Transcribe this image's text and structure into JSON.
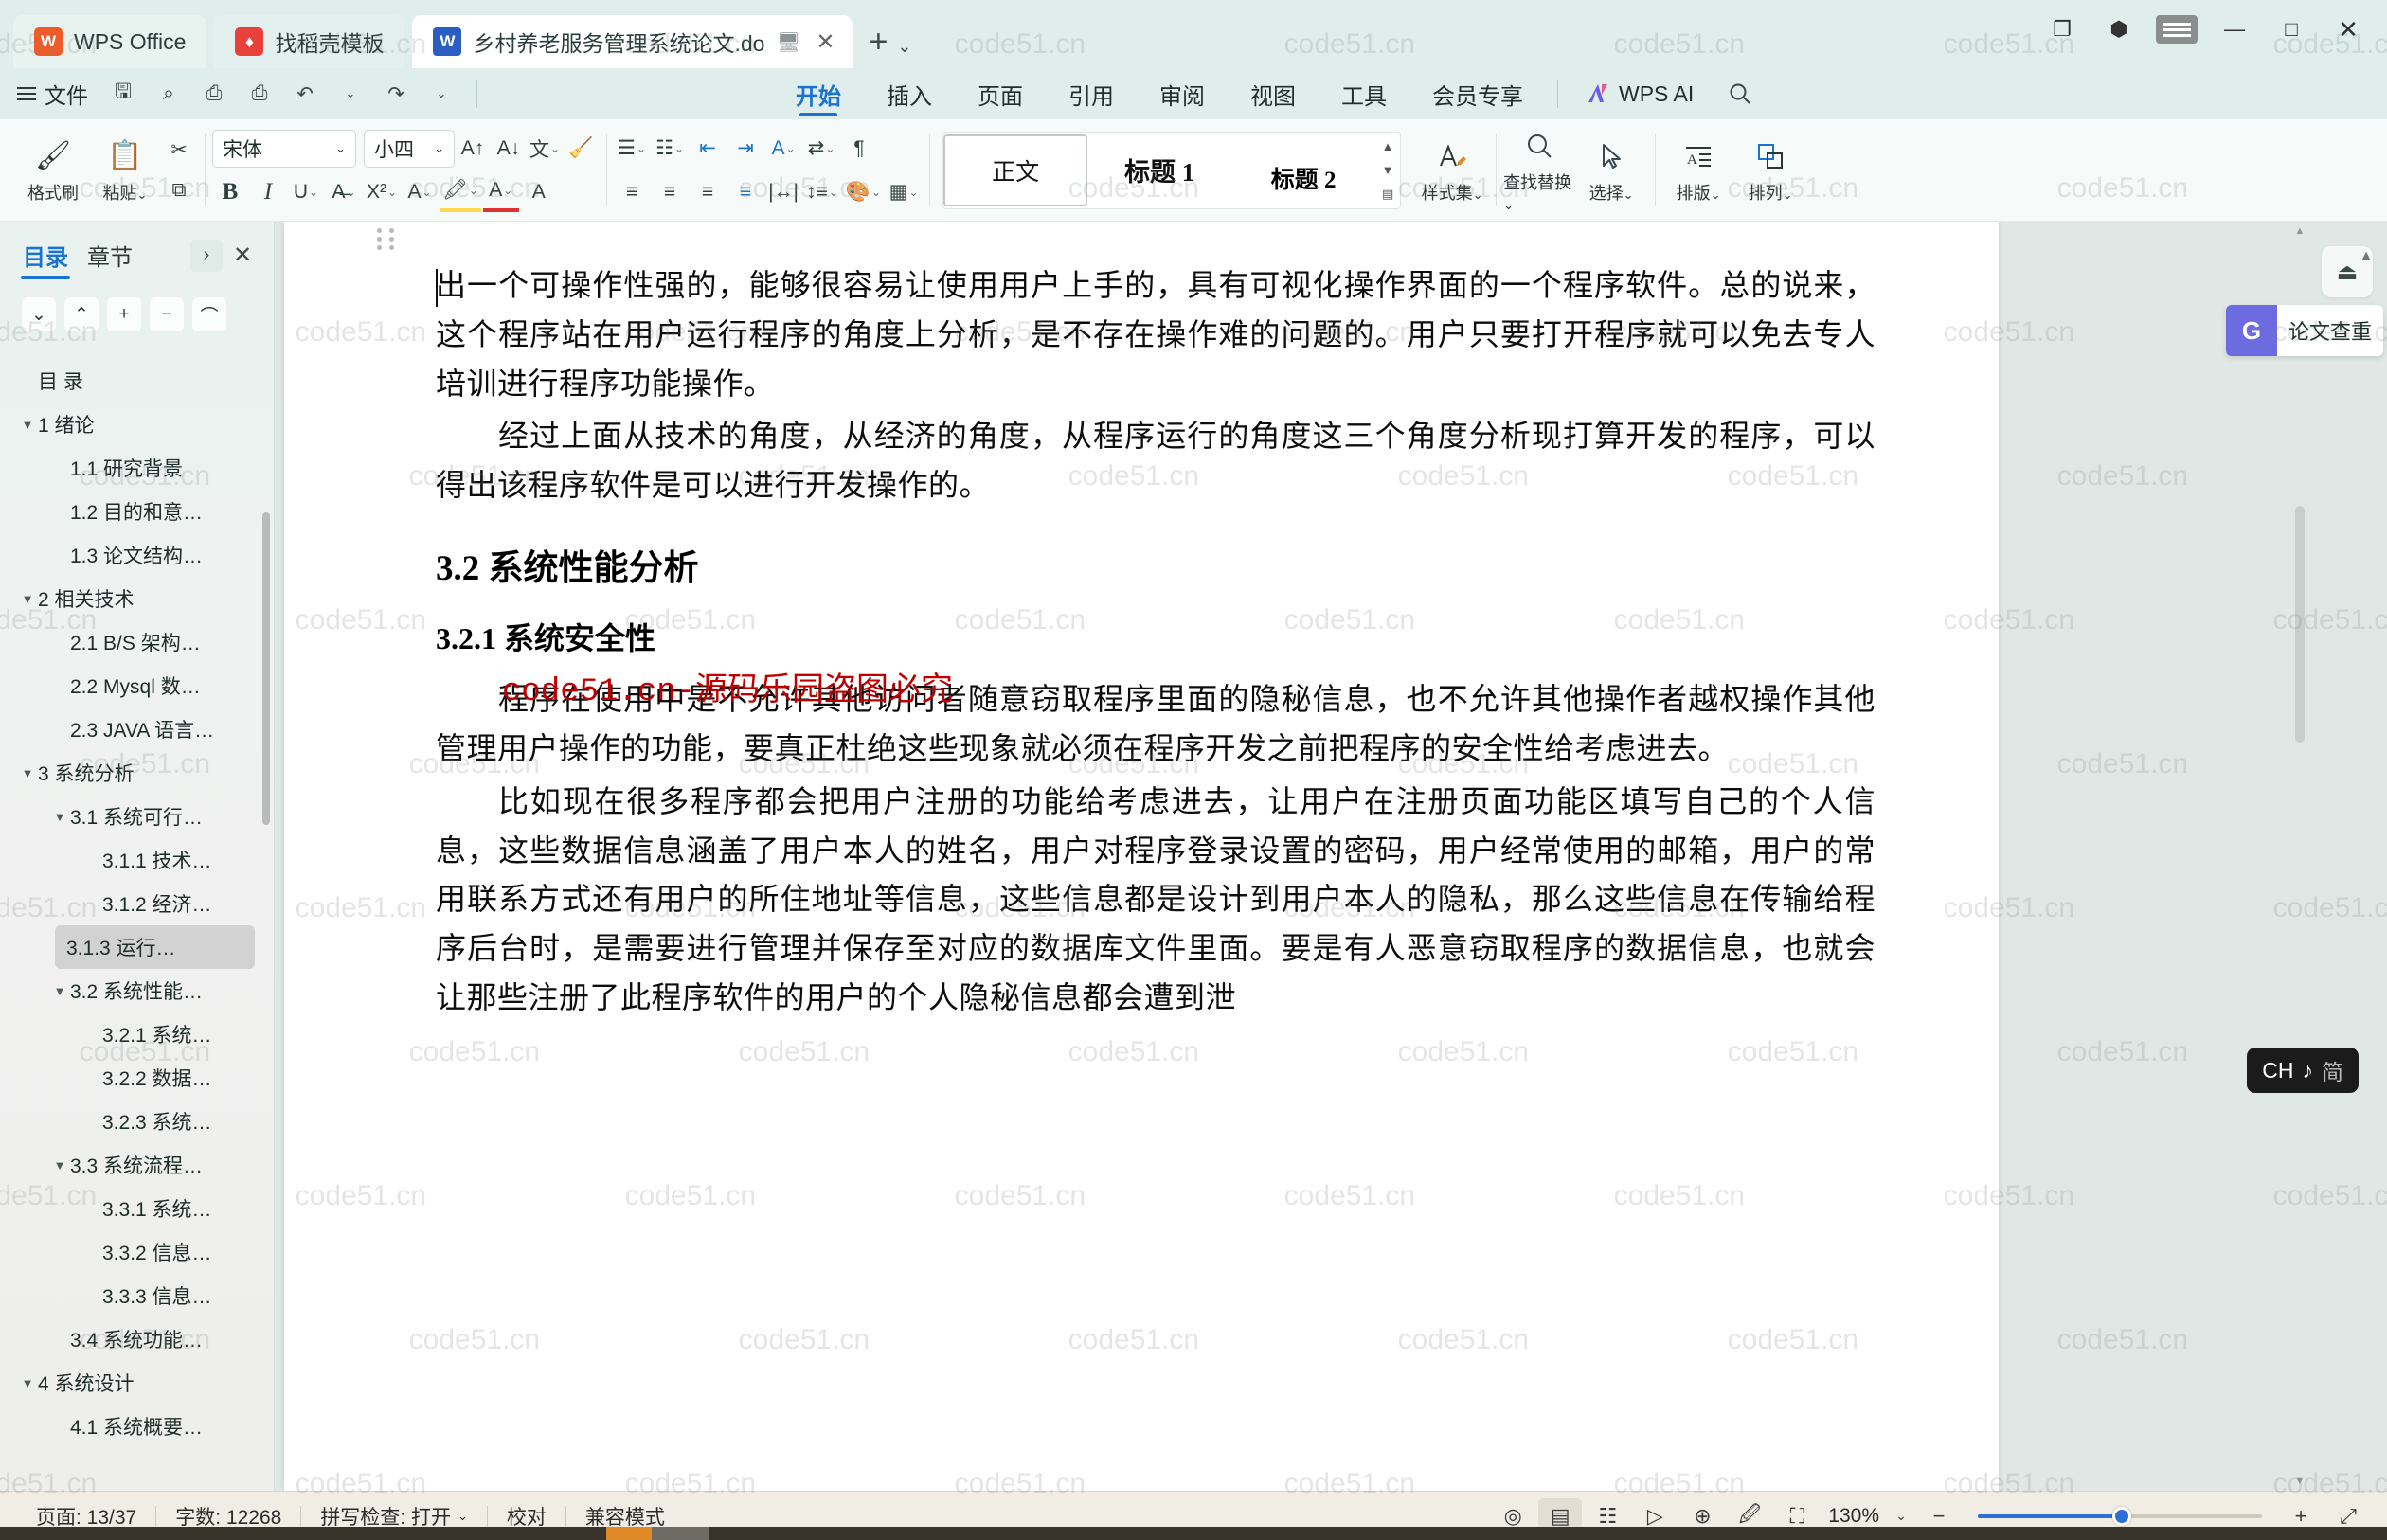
{
  "titlebar": {
    "tabs": [
      {
        "label": "WPS Office",
        "icon": "wps-logo"
      },
      {
        "label": "找稻壳模板",
        "icon": "docer-logo"
      },
      {
        "label": "乡村养老服务管理系统论文.do",
        "icon": "word-doc-icon"
      }
    ],
    "new_tab": "+",
    "tab_list_caret": "⌄",
    "window": {
      "restore": "❐",
      "minimize": "—",
      "maximize": "□",
      "close": "✕"
    }
  },
  "quick_access": {
    "file_menu": "文件",
    "buttons": [
      "save-icon",
      "search-save-icon",
      "print-icon",
      "print-preview-icon",
      "undo-icon",
      "redo-icon",
      "customize-caret"
    ]
  },
  "ribbon_tabs": {
    "items": [
      "开始",
      "插入",
      "页面",
      "引用",
      "审阅",
      "视图",
      "工具",
      "会员专享"
    ],
    "active": "开始",
    "ai": "WPS AI",
    "search": "search-icon"
  },
  "ribbon": {
    "clipboard": {
      "paste": "粘贴",
      "format_painter": "格式刷",
      "cut": "cut-icon",
      "copy": "copy-icon"
    },
    "font": {
      "family": "宋体",
      "size": "小四",
      "grow": "A↑",
      "shrink": "A↓",
      "pinyin": "wén",
      "clear": "clear-format-icon",
      "bold": "B",
      "italic": "I",
      "underline": "U",
      "strike": "S",
      "superscript": "X²",
      "text_effects": "A",
      "highlight": "highlight-icon",
      "font_color": "font-color-icon",
      "char_shading": "A"
    },
    "paragraph": {
      "bullets": "bullet-list-icon",
      "numbering": "numbered-list-icon",
      "decrease_indent": "decrease-indent-icon",
      "increase_indent": "increase-indent-icon",
      "asian_layout": "asian-layout-icon",
      "sort": "sort-icon",
      "show_marks": "show-marks-icon",
      "align_left": "align-left-icon",
      "align_center": "align-center-icon",
      "align_right": "align-right-icon",
      "align_justify": "align-justify-icon",
      "distribute": "distribute-icon",
      "line_spacing": "line-spacing-icon",
      "shading": "shading-icon",
      "borders": "borders-icon"
    },
    "styles": {
      "items": [
        {
          "label": "正文",
          "selected": true
        },
        {
          "label": "标题 1",
          "selected": false
        },
        {
          "label": "标题 2",
          "selected": false
        }
      ]
    },
    "tools": [
      {
        "label": "样式集",
        "icon": "style-set-icon"
      },
      {
        "label": "查找替换",
        "icon": "find-replace-icon"
      },
      {
        "label": "选择",
        "icon": "select-cursor-icon"
      },
      {
        "label": "排版",
        "icon": "typeset-icon"
      },
      {
        "label": "排列",
        "icon": "arrange-icon"
      }
    ]
  },
  "sidebar": {
    "tabs": [
      {
        "label": "目录",
        "active": true
      },
      {
        "label": "章节",
        "active": false
      }
    ],
    "expand": "›",
    "close": "✕",
    "toolbar": [
      "chevron-down-icon",
      "chevron-up-icon",
      "plus-icon",
      "minus-icon",
      "collapse-all-icon"
    ],
    "outline": [
      {
        "label": "目 录",
        "level": 1,
        "expandable": false,
        "selected": false
      },
      {
        "label": "1 绪论",
        "level": 1,
        "expandable": true,
        "selected": false
      },
      {
        "label": "1.1 研究背景",
        "level": 2,
        "expandable": false,
        "selected": false
      },
      {
        "label": "1.2 目的和意…",
        "level": 2,
        "expandable": false,
        "selected": false
      },
      {
        "label": "1.3 论文结构…",
        "level": 2,
        "expandable": false,
        "selected": false
      },
      {
        "label": "2 相关技术",
        "level": 1,
        "expandable": true,
        "selected": false
      },
      {
        "label": "2.1 B/S 架构…",
        "level": 2,
        "expandable": false,
        "selected": false
      },
      {
        "label": "2.2 Mysql 数…",
        "level": 2,
        "expandable": false,
        "selected": false
      },
      {
        "label": "2.3 JAVA 语言…",
        "level": 2,
        "expandable": false,
        "selected": false
      },
      {
        "label": "3 系统分析",
        "level": 1,
        "expandable": true,
        "selected": false
      },
      {
        "label": "3.1 系统可行…",
        "level": 2,
        "expandable": true,
        "selected": false
      },
      {
        "label": "3.1.1 技术…",
        "level": 3,
        "expandable": false,
        "selected": false
      },
      {
        "label": "3.1.2 经济…",
        "level": 3,
        "expandable": false,
        "selected": false
      },
      {
        "label": "3.1.3 运行…",
        "level": 3,
        "expandable": false,
        "selected": true
      },
      {
        "label": "3.2 系统性能…",
        "level": 2,
        "expandable": true,
        "selected": false
      },
      {
        "label": "3.2.1 系统…",
        "level": 3,
        "expandable": false,
        "selected": false
      },
      {
        "label": "3.2.2 数据…",
        "level": 3,
        "expandable": false,
        "selected": false
      },
      {
        "label": "3.2.3 系统…",
        "level": 3,
        "expandable": false,
        "selected": false
      },
      {
        "label": "3.3 系统流程…",
        "level": 2,
        "expandable": true,
        "selected": false
      },
      {
        "label": "3.3.1 系统…",
        "level": 3,
        "expandable": false,
        "selected": false
      },
      {
        "label": "3.3.2 信息…",
        "level": 3,
        "expandable": false,
        "selected": false
      },
      {
        "label": "3.3.3 信息…",
        "level": 3,
        "expandable": false,
        "selected": false
      },
      {
        "label": "3.4 系统功能…",
        "level": 2,
        "expandable": false,
        "selected": false
      },
      {
        "label": "4 系统设计",
        "level": 1,
        "expandable": true,
        "selected": false
      },
      {
        "label": "4.1 系统概要…",
        "level": 2,
        "expandable": false,
        "selected": false
      }
    ]
  },
  "document": {
    "paragraph_1": "出一个可操作性强的，能够很容易让使用用户上手的，具有可视化操作界面的一个程序软件。总的说来，这个程序站在用户运行程序的角度上分析，是不存在操作难的问题的。用户只要打开程序就可以免去专人培训进行程序功能操作。",
    "paragraph_2": "经过上面从技术的角度，从经济的角度，从程序运行的角度这三个角度分析现打算开发的程序，可以得出该程序软件是可以进行开发操作的。",
    "heading_2": "3.2 系统性能分析",
    "heading_3": "3.2.1  系统安全性",
    "watermark_red": "code51.cn-源码乐园盗图必究",
    "paragraph_3": "程序在使用中是不允许其他访问者随意窃取程序里面的隐秘信息，也不允许其他操作者越权操作其他管理用户操作的功能，要真正杜绝这些现象就必须在程序开发之前把程序的安全性给考虑进去。",
    "paragraph_4": "比如现在很多程序都会把用户注册的功能给考虑进去，让用户在注册页面功能区填写自己的个人信息，这些数据信息涵盖了用户本人的姓名，用户对程序登录设置的密码，用户经常使用的邮箱，用户的常用联系方式还有用户的所住地址等信息，这些信息都是设计到用户本人的隐私，那么这些信息在传输给程序后台时，是需要进行管理并保存至对应的数据库文件里面。要是有人恶意窃取程序的数据信息，也就会让那些注册了此程序软件的用户的个人隐秘信息都会遭到泄"
  },
  "watermark_text": "code51.cn",
  "right_rail": {
    "top_button": "share-up-icon",
    "check_panel": {
      "icon": "G",
      "label": "论文查重"
    },
    "scroll_up": "▲"
  },
  "ime": {
    "lang": "CH",
    "mode_icon": "♪",
    "script": "简"
  },
  "statusbar": {
    "page": "页面: 13/37",
    "words": "字数: 12268",
    "spellcheck": "拼写检查: 打开",
    "proofread": "校对",
    "compat": "兼容模式",
    "view_icons": [
      "focus-icon",
      "page-view-icon",
      "outline-view-icon",
      "read-view-icon",
      "web-view-icon",
      "ink-icon",
      "fullscreen-icon"
    ],
    "zoom": "130%",
    "zoom_out": "−",
    "zoom_in": "+",
    "fit": "⤢"
  },
  "colors": {
    "accent": "#1a73d2",
    "ribbon_bg": "#dfeeea",
    "red_watermark": "#c00000",
    "check_purple": "#6c6ce0"
  }
}
